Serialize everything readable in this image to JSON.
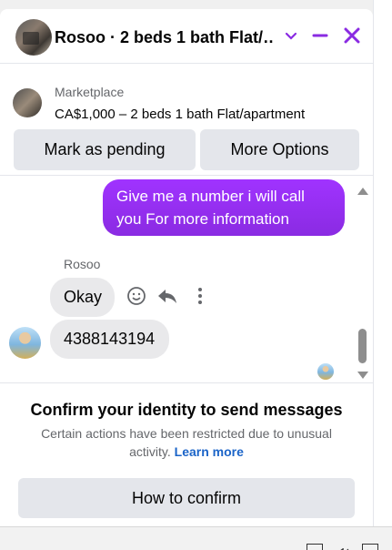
{
  "header": {
    "title": "Rosoo · 2 beds 1 bath Flat/…",
    "accent_color": "#8a2be2",
    "icons": [
      "chevron-down-icon",
      "minimize-icon",
      "close-icon"
    ]
  },
  "marketplace": {
    "label": "Marketplace",
    "listing": "CA$1,000 – 2 beds 1 bath Flat/apartment",
    "buttons": {
      "pending": "Mark as pending",
      "more": "More Options"
    }
  },
  "messages": {
    "outgoing": "Give me a number i will call you For more information",
    "sender_name": "Rosoo",
    "incoming": [
      "Okay",
      "4388143194"
    ],
    "action_icons": [
      "emoji-icon",
      "reply-icon",
      "more-icon"
    ]
  },
  "confirm": {
    "title": "Confirm your identity to send messages",
    "description": "Certain actions have been restricted due to unusual activity.",
    "learn_more": "Learn more",
    "button": "How to confirm"
  }
}
